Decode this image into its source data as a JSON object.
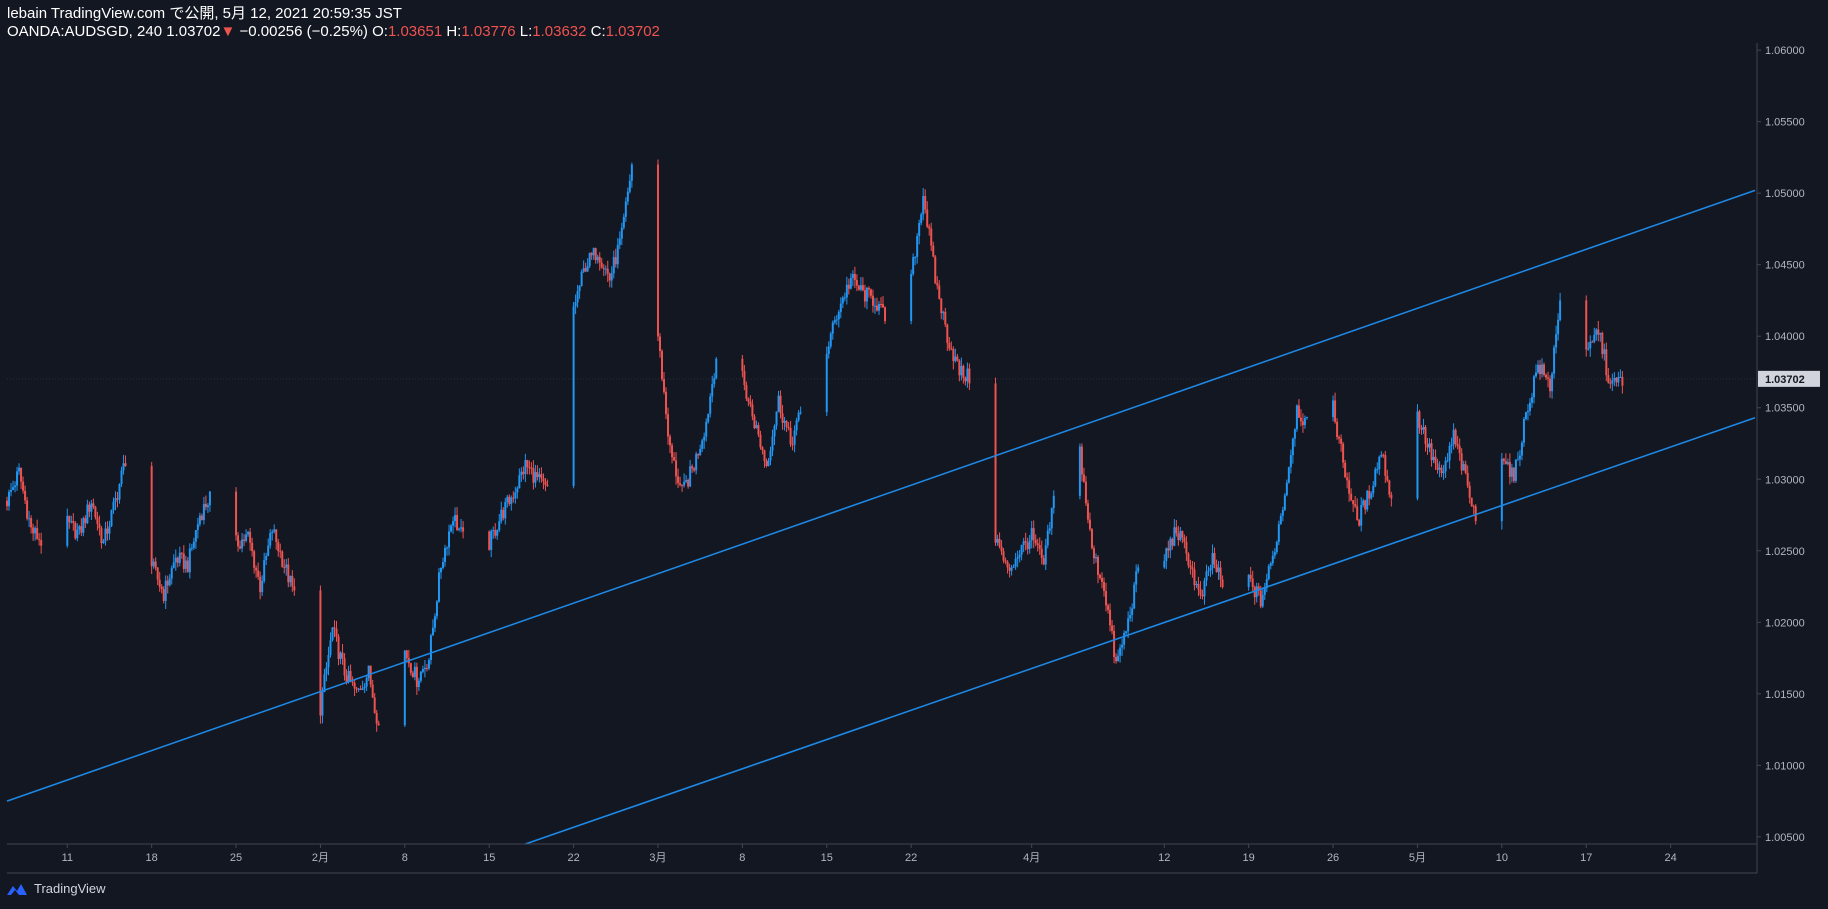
{
  "header": {
    "line1": "lebain TradingView.com で公開, 5月 12, 2021 20:59:35 JST",
    "symbol": "OANDA:AUDSGD, 240",
    "last": "1.03702",
    "change_arrow": "▼",
    "change": "−0.00256 (−0.25%)",
    "o_label": "O:",
    "o_value": "1.03651",
    "h_label": "H:",
    "h_value": "1.03776",
    "l_label": "L:",
    "l_value": "1.03632",
    "c_label": "C:",
    "c_value": "1.03702"
  },
  "footer": {
    "brand": "TradingView",
    "logo_icon": "tradingview-logo-icon"
  },
  "colors": {
    "background": "#131722",
    "up": "#2196f3",
    "down": "#ef5350",
    "channel": "#1e88e5",
    "axis_text": "#b2b5be",
    "price_tag_bg": "#d1d4dc"
  },
  "chart_data": {
    "type": "candlestick",
    "symbol": "OANDA:AUDSGD",
    "timeframe": "240",
    "last_price": 1.03702,
    "last_price_label": "1.03702",
    "y_axis": {
      "range": [
        1.0045,
        1.0605
      ],
      "ticks": [
        {
          "value": 1.005,
          "label": "1.00500"
        },
        {
          "value": 1.01,
          "label": "1.01000"
        },
        {
          "value": 1.015,
          "label": "1.01500"
        },
        {
          "value": 1.02,
          "label": "1.02000"
        },
        {
          "value": 1.025,
          "label": "1.02500"
        },
        {
          "value": 1.03,
          "label": "1.03000"
        },
        {
          "value": 1.035,
          "label": "1.03500"
        },
        {
          "value": 1.04,
          "label": "1.04000"
        },
        {
          "value": 1.045,
          "label": "1.04500"
        },
        {
          "value": 1.05,
          "label": "1.05000"
        },
        {
          "value": 1.055,
          "label": "1.05500"
        },
        {
          "value": 1.06,
          "label": "1.06000"
        }
      ]
    },
    "x_axis": {
      "range": [
        "2021-01-06",
        "2021-05-31"
      ],
      "ticks": [
        {
          "date": "2021-01-11",
          "label": "11"
        },
        {
          "date": "2021-01-18",
          "label": "18"
        },
        {
          "date": "2021-01-25",
          "label": "25"
        },
        {
          "date": "2021-02-01",
          "label": "2月"
        },
        {
          "date": "2021-02-08",
          "label": "8"
        },
        {
          "date": "2021-02-15",
          "label": "15"
        },
        {
          "date": "2021-02-22",
          "label": "22"
        },
        {
          "date": "2021-03-01",
          "label": "3月"
        },
        {
          "date": "2021-03-08",
          "label": "8"
        },
        {
          "date": "2021-03-15",
          "label": "15"
        },
        {
          "date": "2021-03-22",
          "label": "22"
        },
        {
          "date": "2021-04-01",
          "label": "4月"
        },
        {
          "date": "2021-04-12",
          "label": "12"
        },
        {
          "date": "2021-04-19",
          "label": "19"
        },
        {
          "date": "2021-04-26",
          "label": "26"
        },
        {
          "date": "2021-05-03",
          "label": "5月"
        },
        {
          "date": "2021-05-10",
          "label": "10"
        },
        {
          "date": "2021-05-17",
          "label": "17"
        },
        {
          "date": "2021-05-24",
          "label": "24"
        }
      ]
    },
    "close_path": [
      [
        "2021-01-06",
        1.0285
      ],
      [
        "2021-01-07",
        1.0305
      ],
      [
        "2021-01-08",
        1.0265
      ],
      [
        "2021-01-09",
        1.0255
      ],
      [
        "2021-01-10",
        1.0275
      ],
      [
        "2021-01-12",
        1.0262
      ],
      [
        "2021-01-13",
        1.0285
      ],
      [
        "2021-01-14",
        1.0255
      ],
      [
        "2021-01-15",
        1.0285
      ],
      [
        "2021-01-16",
        1.032
      ],
      [
        "2021-01-17",
        1.029
      ],
      [
        "2021-01-18",
        1.024
      ],
      [
        "2021-01-19",
        1.022
      ],
      [
        "2021-01-20",
        1.0245
      ],
      [
        "2021-01-21",
        1.024
      ],
      [
        "2021-01-22",
        1.0275
      ],
      [
        "2021-01-23",
        1.029
      ],
      [
        "2021-01-24",
        1.0265
      ],
      [
        "2021-01-25",
        1.0255
      ],
      [
        "2021-01-26",
        1.026
      ],
      [
        "2021-01-27",
        1.0225
      ],
      [
        "2021-01-28",
        1.0265
      ],
      [
        "2021-01-29",
        1.024
      ],
      [
        "2021-01-30",
        1.0215
      ],
      [
        "2021-01-31",
        1.0175
      ],
      [
        "2021-02-01",
        1.014
      ],
      [
        "2021-02-02",
        1.0195
      ],
      [
        "2021-02-03",
        1.0165
      ],
      [
        "2021-02-04",
        1.015
      ],
      [
        "2021-02-05",
        1.0165
      ],
      [
        "2021-02-06",
        1.012
      ],
      [
        "2021-02-07",
        1.016
      ],
      [
        "2021-02-08",
        1.018
      ],
      [
        "2021-02-09",
        1.016
      ],
      [
        "2021-02-10",
        1.0175
      ],
      [
        "2021-02-11",
        1.024
      ],
      [
        "2021-02-12",
        1.0275
      ],
      [
        "2021-02-13",
        1.0255
      ],
      [
        "2021-02-14",
        1.0265
      ],
      [
        "2021-02-15",
        1.0255
      ],
      [
        "2021-02-16",
        1.0275
      ],
      [
        "2021-02-17",
        1.029
      ],
      [
        "2021-02-18",
        1.031
      ],
      [
        "2021-02-19",
        1.03
      ],
      [
        "2021-02-20",
        1.029
      ],
      [
        "2021-02-21",
        1.03
      ],
      [
        "2021-02-22",
        1.042
      ],
      [
        "2021-02-23",
        1.045
      ],
      [
        "2021-02-24",
        1.046
      ],
      [
        "2021-02-25",
        1.044
      ],
      [
        "2021-02-26",
        1.047
      ],
      [
        "2021-02-27",
        1.053
      ],
      [
        "2021-02-28",
        1.048
      ],
      [
        "2021-03-01",
        1.04
      ],
      [
        "2021-03-02",
        1.032
      ],
      [
        "2021-03-03",
        1.029
      ],
      [
        "2021-03-04",
        1.031
      ],
      [
        "2021-03-05",
        1.034
      ],
      [
        "2021-03-06",
        1.0395
      ],
      [
        "2021-03-07",
        1.038
      ],
      [
        "2021-03-08",
        1.037
      ],
      [
        "2021-03-09",
        1.034
      ],
      [
        "2021-03-10",
        1.031
      ],
      [
        "2021-03-11",
        1.0355
      ],
      [
        "2021-03-12",
        1.0325
      ],
      [
        "2021-03-13",
        1.035
      ],
      [
        "2021-03-14",
        1.0375
      ],
      [
        "2021-03-15",
        1.039
      ],
      [
        "2021-03-16",
        1.042
      ],
      [
        "2021-03-17",
        1.044
      ],
      [
        "2021-03-18",
        1.043
      ],
      [
        "2021-03-19",
        1.0425
      ],
      [
        "2021-03-20",
        1.041
      ],
      [
        "2021-03-21",
        1.0385
      ],
      [
        "2021-03-22",
        1.044
      ],
      [
        "2021-03-23",
        1.05
      ],
      [
        "2021-03-24",
        1.044
      ],
      [
        "2021-03-25",
        1.04
      ],
      [
        "2021-03-26",
        1.0375
      ],
      [
        "2021-03-27",
        1.037
      ],
      [
        "2021-03-28",
        1.03
      ],
      [
        "2021-03-29",
        1.026
      ],
      [
        "2021-03-30",
        1.0235
      ],
      [
        "2021-03-31",
        1.025
      ],
      [
        "2021-04-01",
        1.026
      ],
      [
        "2021-04-02",
        1.024
      ],
      [
        "2021-04-03",
        1.0295
      ],
      [
        "2021-04-04",
        1.0265
      ],
      [
        "2021-04-05",
        1.032
      ],
      [
        "2021-04-06",
        1.025
      ],
      [
        "2021-04-07",
        1.0225
      ],
      [
        "2021-04-08",
        1.017
      ],
      [
        "2021-04-09",
        1.02
      ],
      [
        "2021-04-10",
        1.0245
      ],
      [
        "2021-04-11",
        1.026
      ],
      [
        "2021-04-12",
        1.0245
      ],
      [
        "2021-04-13",
        1.0265
      ],
      [
        "2021-04-14",
        1.0245
      ],
      [
        "2021-04-15",
        1.0215
      ],
      [
        "2021-04-16",
        1.0245
      ],
      [
        "2021-04-17",
        1.022
      ],
      [
        "2021-04-18",
        1.021
      ],
      [
        "2021-04-19",
        1.023
      ],
      [
        "2021-04-20",
        1.0215
      ],
      [
        "2021-04-21",
        1.0245
      ],
      [
        "2021-04-22",
        1.029
      ],
      [
        "2021-04-23",
        1.035
      ],
      [
        "2021-04-24",
        1.0335
      ],
      [
        "2021-04-25",
        1.0315
      ],
      [
        "2021-04-26",
        1.035
      ],
      [
        "2021-04-27",
        1.0305
      ],
      [
        "2021-04-28",
        1.027
      ],
      [
        "2021-04-29",
        1.029
      ],
      [
        "2021-04-30",
        1.032
      ],
      [
        "2021-05-01",
        1.028
      ],
      [
        "2021-05-02",
        1.029
      ],
      [
        "2021-05-03",
        1.0345
      ],
      [
        "2021-05-04",
        1.032
      ],
      [
        "2021-05-05",
        1.03
      ],
      [
        "2021-05-06",
        1.033
      ],
      [
        "2021-05-07",
        1.03
      ],
      [
        "2021-05-08",
        1.0265
      ],
      [
        "2021-05-09",
        1.029
      ],
      [
        "2021-05-10",
        1.032
      ],
      [
        "2021-05-11",
        1.03
      ],
      [
        "2021-05-12",
        1.0345
      ],
      [
        "2021-05-13",
        1.038
      ],
      [
        "2021-05-14",
        1.0365
      ],
      [
        "2021-05-15",
        1.044
      ],
      [
        "2021-05-16",
        1.04
      ],
      [
        "2021-05-17",
        1.0385
      ],
      [
        "2021-05-18",
        1.0405
      ],
      [
        "2021-05-19",
        1.0365
      ],
      [
        "2021-05-20",
        1.037
      ]
    ],
    "trend_lines": [
      {
        "from": [
          "2021-01-06",
          1.0075
        ],
        "to": [
          "2021-05-31",
          1.0502
        ]
      },
      {
        "from": [
          "2021-02-18",
          1.0045
        ],
        "to": [
          "2021-05-31",
          1.0343
        ]
      }
    ]
  }
}
